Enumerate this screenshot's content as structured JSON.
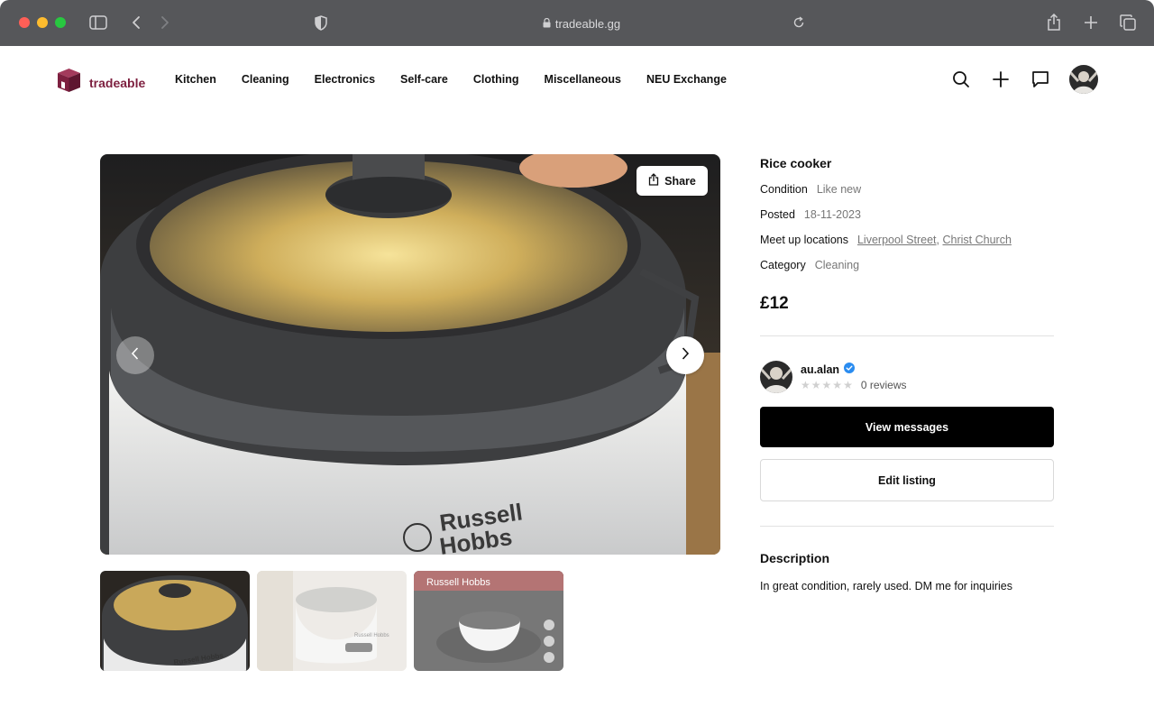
{
  "browser": {
    "url": "tradeable.gg"
  },
  "brand": {
    "name": "tradeable",
    "color": "#7d1f3f"
  },
  "nav": {
    "items": [
      "Kitchen",
      "Cleaning",
      "Electronics",
      "Self-care",
      "Clothing",
      "Miscellaneous",
      "NEU Exchange"
    ],
    "icons": [
      "search-icon",
      "plus-icon",
      "chat-icon",
      "avatar"
    ]
  },
  "gallery": {
    "share_label": "Share",
    "thumbnail_count": 3
  },
  "listing": {
    "title": "Rice cooker",
    "condition_label": "Condition",
    "condition_value": "Like new",
    "posted_label": "Posted",
    "posted_value": "18-11-2023",
    "meetup_label": "Meet up locations",
    "meetup_locations": [
      "Liverpool Street",
      "Christ Church"
    ],
    "category_label": "Category",
    "category_value": "Cleaning",
    "price": "£12"
  },
  "seller": {
    "username": "au.alan",
    "verified": true,
    "rating_stars": 0,
    "reviews": "0 reviews"
  },
  "actions": {
    "view_messages": "View messages",
    "edit_listing": "Edit listing"
  },
  "description": {
    "title": "Description",
    "text": "In great condition, rarely used. DM me for inquiries"
  }
}
